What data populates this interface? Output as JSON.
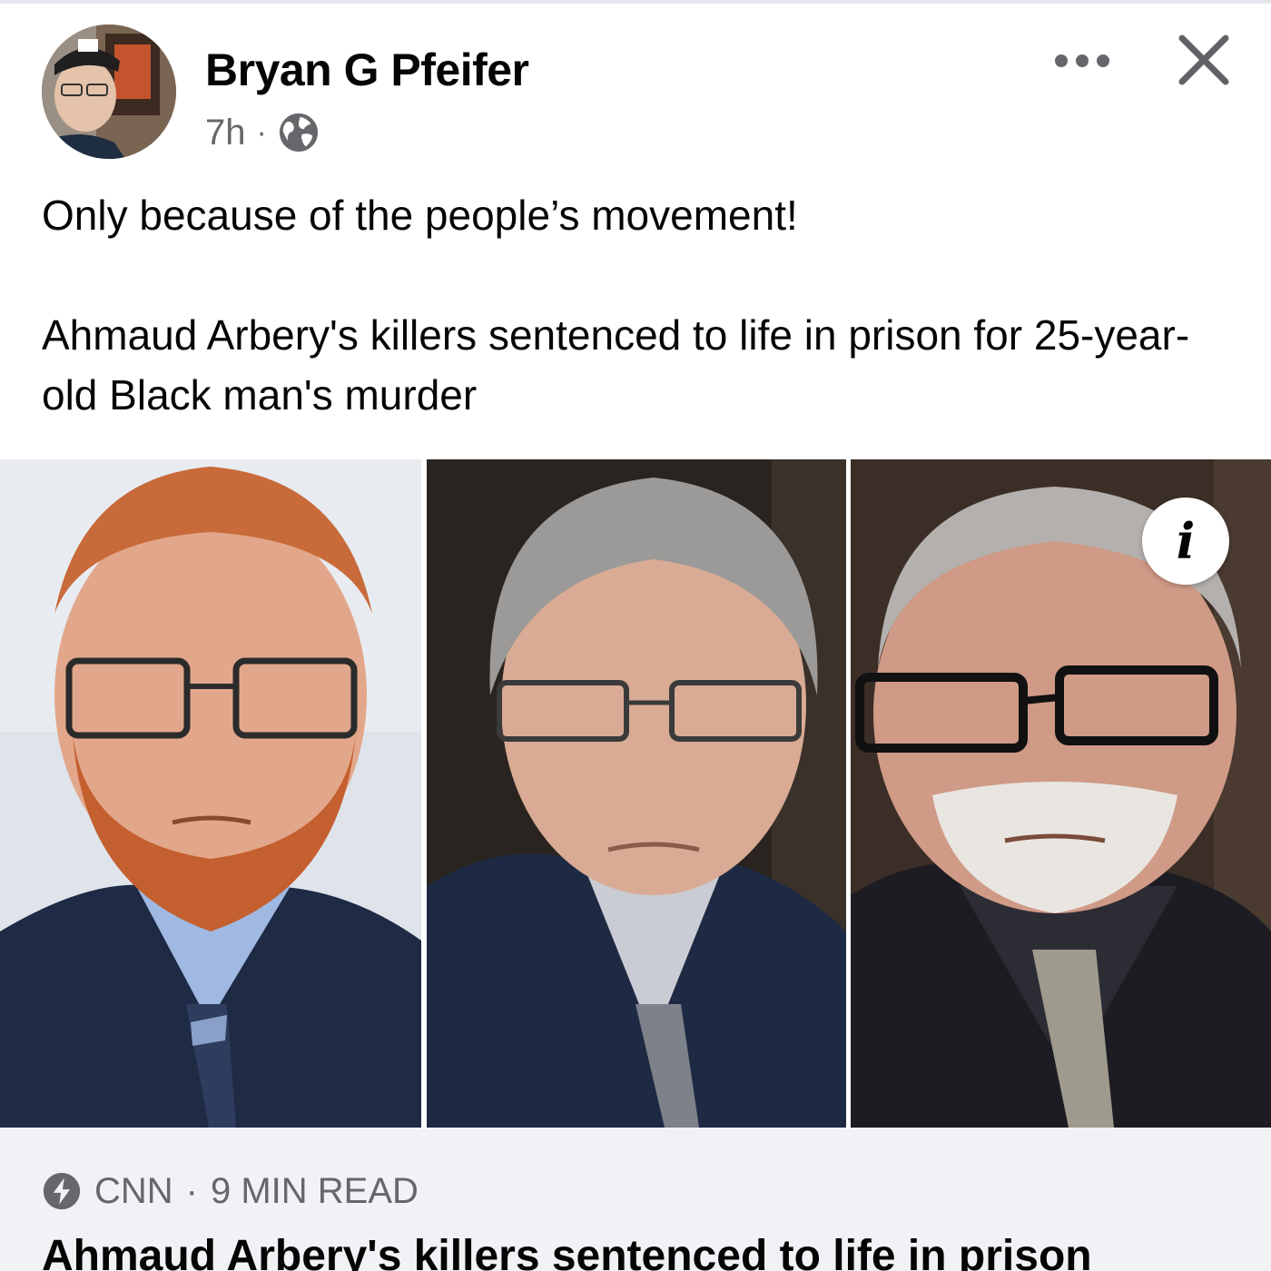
{
  "post": {
    "author": "Bryan G Pfeifer",
    "time": "7h",
    "separator": "·",
    "audience_icon": "globe-icon",
    "text_line_1": "Only because of the people’s movement!",
    "text_line_2": "Ahmaud Arbery's killers sentenced to life in prison for 25-year-old Black man's murder"
  },
  "header_actions": {
    "more_icon": "more-horizontal-icon",
    "close_icon": "close-icon"
  },
  "image": {
    "info_badge": "i"
  },
  "link_preview": {
    "source": "CNN",
    "separator": "·",
    "read_time": "9 MIN READ",
    "title": "Ahmaud Arbery's killers sentenced to life in prison",
    "source_icon": "instant-article-bolt-icon"
  },
  "colors": {
    "text_primary": "#050505",
    "text_secondary": "#65676b",
    "preview_background": "#f0f2f5"
  }
}
